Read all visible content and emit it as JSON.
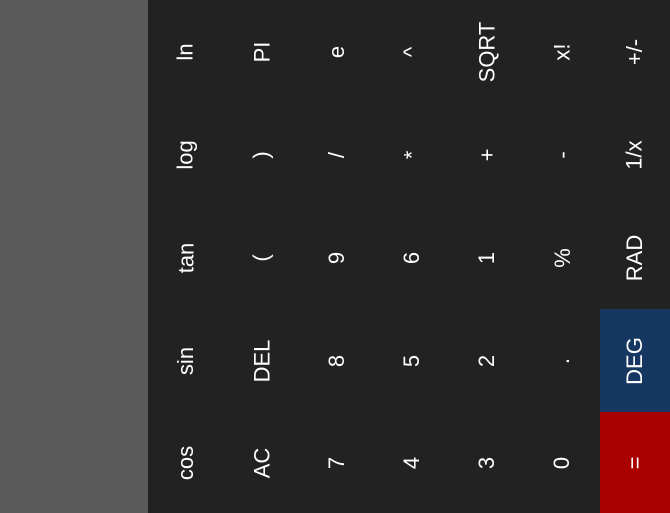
{
  "display": {
    "expression": "",
    "result": ""
  },
  "keys": {
    "ln": "ln",
    "log": "log",
    "tan": "tan",
    "sin": "sin",
    "cos": "cos",
    "pi": "PI",
    "close_paren": ")",
    "open_paren": "(",
    "del": "DEL",
    "ac": "AC",
    "e": "e",
    "divide": "/",
    "nine": "9",
    "eight": "8",
    "seven": "7",
    "power": "^",
    "multiply": "*",
    "six": "6",
    "five": "5",
    "four": "4",
    "sqrt": "SQRT",
    "plus": "+",
    "one": "1",
    "two": "2",
    "three": "3",
    "factorial": "x!",
    "minus": "-",
    "percent": "%",
    "decimal": ".",
    "zero": "0",
    "negate": "+/-",
    "reciprocal": "1/x",
    "rad": "RAD",
    "deg": "DEG",
    "equals": "="
  },
  "colors": {
    "display_bg": "#5a5a5a",
    "keypad_bg": "#222222",
    "key_text": "#ffffff",
    "deg_active": "#163761",
    "equals": "#aa0000"
  }
}
